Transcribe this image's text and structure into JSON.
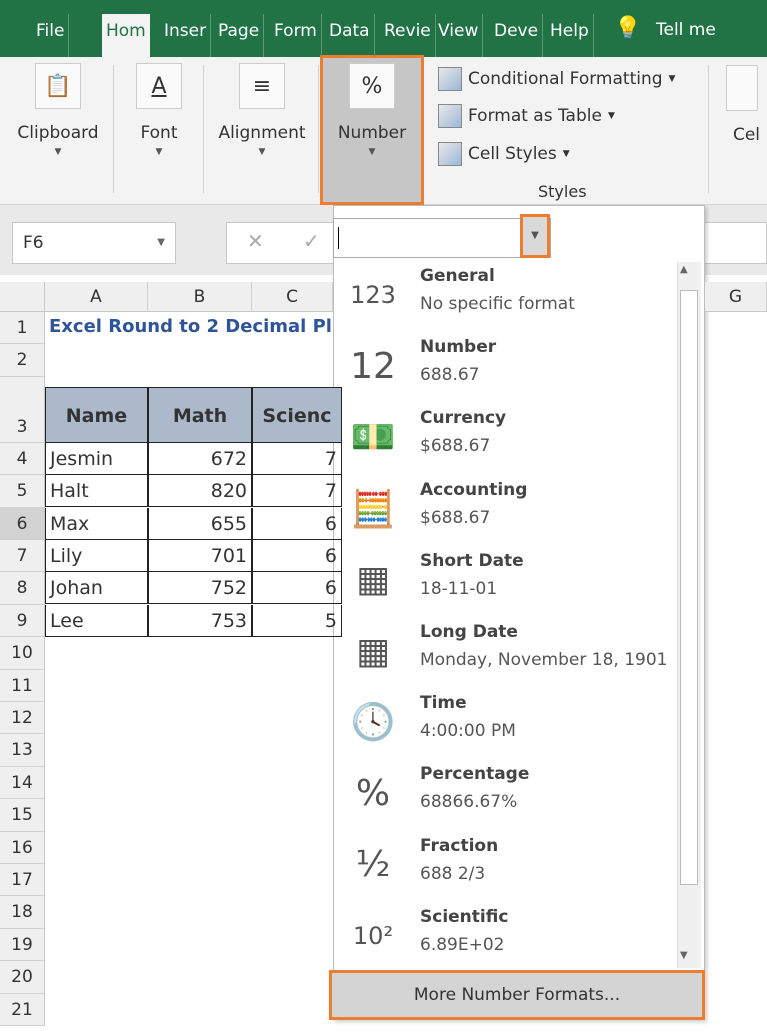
{
  "tabs": [
    "File",
    "Hom",
    "Inser",
    "Page",
    "Form",
    "Data",
    "Revie",
    "View",
    "Deve",
    "Help"
  ],
  "tell_me": "Tell me",
  "ribbon": {
    "groups": [
      {
        "label": "Clipboard",
        "icon": "clipboard-icon"
      },
      {
        "label": "Font",
        "icon": "font-color-icon"
      },
      {
        "label": "Alignment",
        "icon": "align-icon"
      },
      {
        "label": "Number",
        "icon": "percent-icon",
        "glyph": "%"
      }
    ],
    "styles": {
      "items": [
        "Conditional Formatting",
        "Format as Table",
        "Cell Styles"
      ],
      "label": "Styles"
    },
    "cells_label": "Cel"
  },
  "name_box": "F6",
  "number_format_input": "",
  "columns": [
    "A",
    "B",
    "C",
    "G"
  ],
  "rows": [
    "1",
    "2",
    "3",
    "4",
    "5",
    "6",
    "7",
    "8",
    "9",
    "10",
    "11",
    "12",
    "13",
    "14",
    "15",
    "16",
    "17",
    "18",
    "19",
    "20",
    "21"
  ],
  "sheet": {
    "title": "Excel Round to 2 Decimal Pl",
    "headers": [
      "Name",
      "Math",
      "Scienc"
    ],
    "data": [
      [
        "Jesmin",
        "672",
        "7"
      ],
      [
        "Halt",
        "820",
        "7"
      ],
      [
        "Max",
        "655",
        "6"
      ],
      [
        "Lily",
        "701",
        "6"
      ],
      [
        "Johan",
        "752",
        "6"
      ],
      [
        "Lee",
        "753",
        "5"
      ]
    ]
  },
  "formats": [
    {
      "name": "General",
      "example": "No specific format",
      "icon": "general-clock-123-icon",
      "glyph": "123"
    },
    {
      "name": "Number",
      "example": "688.67",
      "icon": "number-12-icon",
      "glyph": "12"
    },
    {
      "name": "Currency",
      "example": "$688.67",
      "icon": "currency-icon",
      "glyph": "💵"
    },
    {
      "name": "Accounting",
      "example": " $688.67",
      "icon": "accounting-icon",
      "glyph": "🧮"
    },
    {
      "name": "Short Date",
      "example": "18-11-01",
      "icon": "calendar-icon",
      "glyph": "▦"
    },
    {
      "name": "Long Date",
      "example": "Monday, November 18, 1901",
      "icon": "calendar-icon",
      "glyph": "▦"
    },
    {
      "name": "Time",
      "example": "4:00:00 PM",
      "icon": "clock-icon",
      "glyph": "🕓"
    },
    {
      "name": "Percentage",
      "example": "68866.67%",
      "icon": "percent-icon",
      "glyph": "%"
    },
    {
      "name": "Fraction",
      "example": "688 2/3",
      "icon": "fraction-icon",
      "glyph": "½"
    },
    {
      "name": "Scientific",
      "example": "6.89E+02",
      "icon": "scientific-icon",
      "glyph": "10²"
    }
  ],
  "more_formats": "More Number Formats...",
  "colors": {
    "excel_green": "#217346",
    "highlight": "#ed7d31",
    "header_fill": "#acb9ca",
    "title_text": "#2f5597"
  }
}
